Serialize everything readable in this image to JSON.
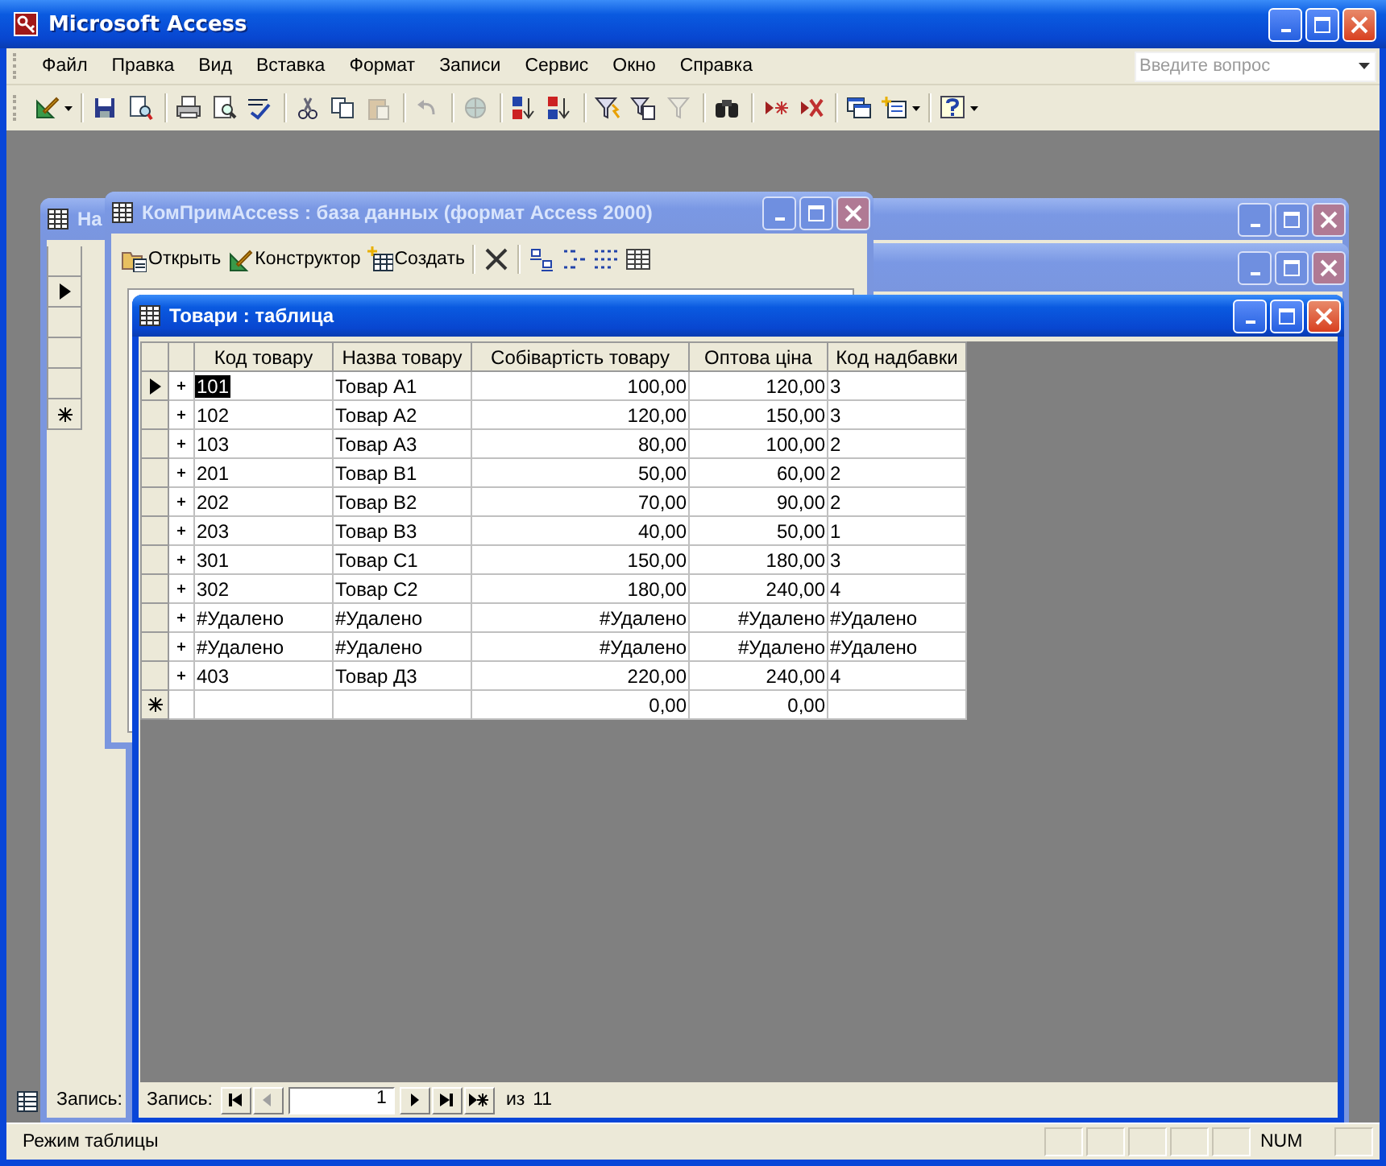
{
  "window": {
    "title": "Microsoft Access"
  },
  "menu": [
    {
      "label": "Файл"
    },
    {
      "label": "Правка"
    },
    {
      "label": "Вид"
    },
    {
      "label": "Вставка"
    },
    {
      "label": "Формат"
    },
    {
      "label": "Записи"
    },
    {
      "label": "Сервис"
    },
    {
      "label": "Окно"
    },
    {
      "label": "Справка"
    }
  ],
  "question_box": {
    "placeholder": "Введите вопрос"
  },
  "toolbar": [
    {
      "kind": "dropdown",
      "disabled": false
    },
    {
      "kind": "separator"
    },
    {
      "kind": "button",
      "disabled": false
    },
    {
      "kind": "button",
      "disabled": false
    },
    {
      "kind": "separator"
    },
    {
      "kind": "button",
      "disabled": false
    },
    {
      "kind": "button",
      "disabled": false
    },
    {
      "kind": "button",
      "disabled": false
    },
    {
      "kind": "separator"
    },
    {
      "kind": "button",
      "disabled": false
    },
    {
      "kind": "button",
      "disabled": false
    },
    {
      "kind": "button",
      "disabled": true
    },
    {
      "kind": "separator"
    },
    {
      "kind": "button",
      "disabled": true
    },
    {
      "kind": "separator"
    },
    {
      "kind": "button",
      "disabled": true
    },
    {
      "kind": "separator"
    },
    {
      "kind": "button",
      "disabled": false
    },
    {
      "kind": "button",
      "disabled": false
    },
    {
      "kind": "separator"
    },
    {
      "kind": "button",
      "disabled": false
    },
    {
      "kind": "button",
      "disabled": false
    },
    {
      "kind": "button",
      "disabled": true
    },
    {
      "kind": "separator"
    },
    {
      "kind": "button",
      "disabled": false
    },
    {
      "kind": "separator"
    },
    {
      "kind": "button",
      "disabled": false
    },
    {
      "kind": "button",
      "disabled": false
    },
    {
      "kind": "separator"
    },
    {
      "kind": "button",
      "disabled": false
    },
    {
      "kind": "dropdown",
      "disabled": false
    },
    {
      "kind": "separator"
    },
    {
      "kind": "dropdown",
      "disabled": false
    }
  ],
  "back_window": {
    "title": "На",
    "record_label": "Запись:"
  },
  "database_window": {
    "title": "КомПримAccess : база данных (формат Access 2000)",
    "toolbar": [
      {
        "kind": "labeled",
        "label": "Открыть"
      },
      {
        "kind": "labeled",
        "label": "Конструктор"
      },
      {
        "kind": "labeled",
        "label": "Создать"
      },
      {
        "kind": "separator"
      },
      {
        "kind": "icon"
      },
      {
        "kind": "separator"
      },
      {
        "kind": "icon"
      },
      {
        "kind": "icon"
      },
      {
        "kind": "icon"
      },
      {
        "kind": "icon"
      }
    ]
  },
  "table_window": {
    "title": "Товари : таблица",
    "columns": [
      {
        "label": "Код товару",
        "numeric": false
      },
      {
        "label": "Назва товару",
        "numeric": false
      },
      {
        "label": "Собівартість товару",
        "numeric": true
      },
      {
        "label": "Оптова ціна",
        "numeric": true
      },
      {
        "label": "Код надбавки",
        "numeric": false
      }
    ],
    "rows": [
      {
        "kind": "record",
        "selected": true,
        "cells": [
          "101",
          "Товар А1",
          "100,00",
          "120,00",
          "3"
        ]
      },
      {
        "kind": "record",
        "selected": false,
        "cells": [
          "102",
          "Товар А2",
          "120,00",
          "150,00",
          "3"
        ]
      },
      {
        "kind": "record",
        "selected": false,
        "cells": [
          "103",
          "Товар А3",
          "80,00",
          "100,00",
          "2"
        ]
      },
      {
        "kind": "record",
        "selected": false,
        "cells": [
          "201",
          "Товар В1",
          "50,00",
          "60,00",
          "2"
        ]
      },
      {
        "kind": "record",
        "selected": false,
        "cells": [
          "202",
          "Товар В2",
          "70,00",
          "90,00",
          "2"
        ]
      },
      {
        "kind": "record",
        "selected": false,
        "cells": [
          "203",
          "Товар В3",
          "40,00",
          "50,00",
          "1"
        ]
      },
      {
        "kind": "record",
        "selected": false,
        "cells": [
          "301",
          "Товар С1",
          "150,00",
          "180,00",
          "3"
        ]
      },
      {
        "kind": "record",
        "selected": false,
        "cells": [
          "302",
          "Товар С2",
          "180,00",
          "240,00",
          "4"
        ]
      },
      {
        "kind": "record",
        "selected": false,
        "cells": [
          "#Удалено",
          "#Удалено",
          "#Удалено",
          "#Удалено",
          "#Удалено"
        ]
      },
      {
        "kind": "record",
        "selected": false,
        "cells": [
          "#Удалено",
          "#Удалено",
          "#Удалено",
          "#Удалено",
          "#Удалено"
        ]
      },
      {
        "kind": "record",
        "selected": false,
        "cells": [
          "403",
          "Товар Д3",
          "220,00",
          "240,00",
          "4"
        ]
      },
      {
        "kind": "new",
        "selected": false,
        "cells": [
          "",
          "",
          "0,00",
          "0,00",
          ""
        ]
      }
    ],
    "navigator": {
      "label": "Запись:",
      "current": "1",
      "of_label": "из",
      "count": "11"
    }
  },
  "status_bar": {
    "mode": "Режим таблицы",
    "indicator": "NUM"
  }
}
